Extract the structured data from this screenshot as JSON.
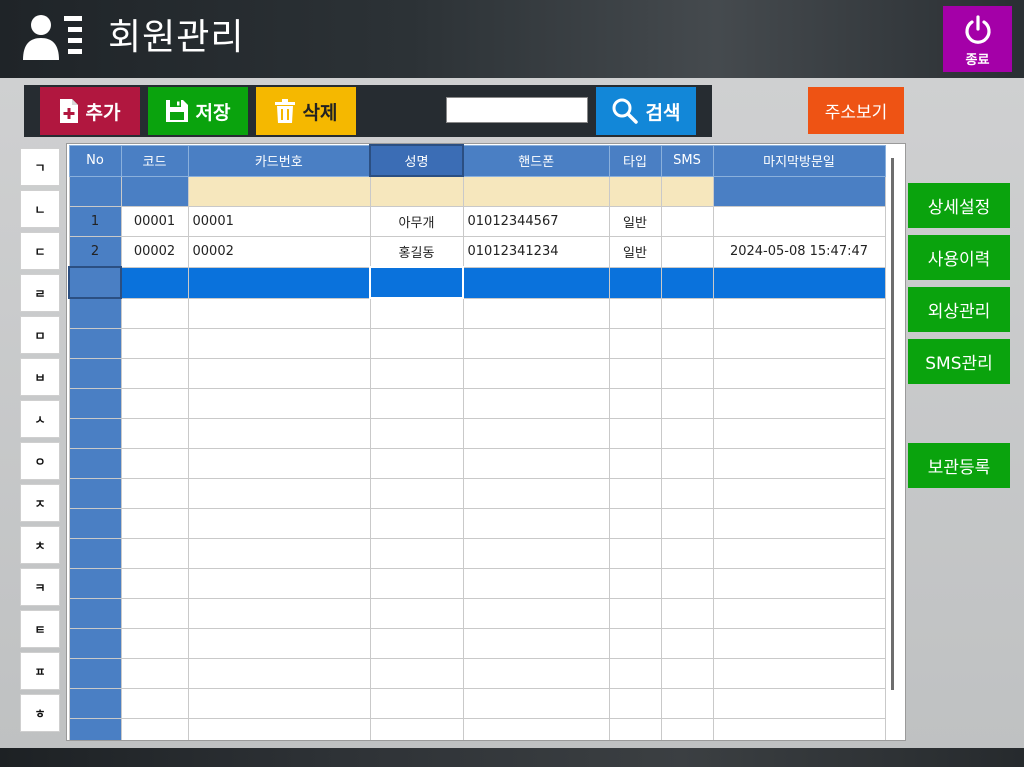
{
  "header": {
    "title": "회원관리",
    "exit_label": "종료",
    "icon": "members-icon"
  },
  "toolbar": {
    "add_label": "추가",
    "save_label": "저장",
    "delete_label": "삭제",
    "search_value": "",
    "search_label": "검색",
    "address_label": "주소보기"
  },
  "consonants": [
    "ㄱ",
    "ㄴ",
    "ㄷ",
    "ㄹ",
    "ㅁ",
    "ㅂ",
    "ㅅ",
    "ㅇ",
    "ㅈ",
    "ㅊ",
    "ㅋ",
    "ㅌ",
    "ㅍ",
    "ㅎ"
  ],
  "grid": {
    "columns": [
      "No",
      "코드",
      "카드번호",
      "성명",
      "핸드폰",
      "타입",
      "SMS",
      "마지막방문일"
    ],
    "rows": [
      [
        "1",
        "00001",
        "00001",
        "아무개",
        "01012344567",
        "일반",
        "",
        ""
      ],
      [
        "2",
        "00002",
        "00002",
        "홍길동",
        "01012341234",
        "일반",
        "",
        "2024-05-08 15:47:47"
      ]
    ],
    "empty_rows_below": 16
  },
  "side_menu": {
    "detail_settings": "상세설정",
    "usage_history": "사용이력",
    "credit_management": "외상관리",
    "sms_management": "SMS관리",
    "storage_registration": "보관등록"
  },
  "colors": {
    "header_bg": "#262c31",
    "add": "#b1173f",
    "save": "#0aa30d",
    "delete": "#f5b800",
    "search": "#1287d8",
    "address": "#ee5314",
    "exit": "#a400a8",
    "grid_header": "#4a7fc4",
    "selected_row": "#0a72dc",
    "filter_row": "#f6e7bd"
  }
}
